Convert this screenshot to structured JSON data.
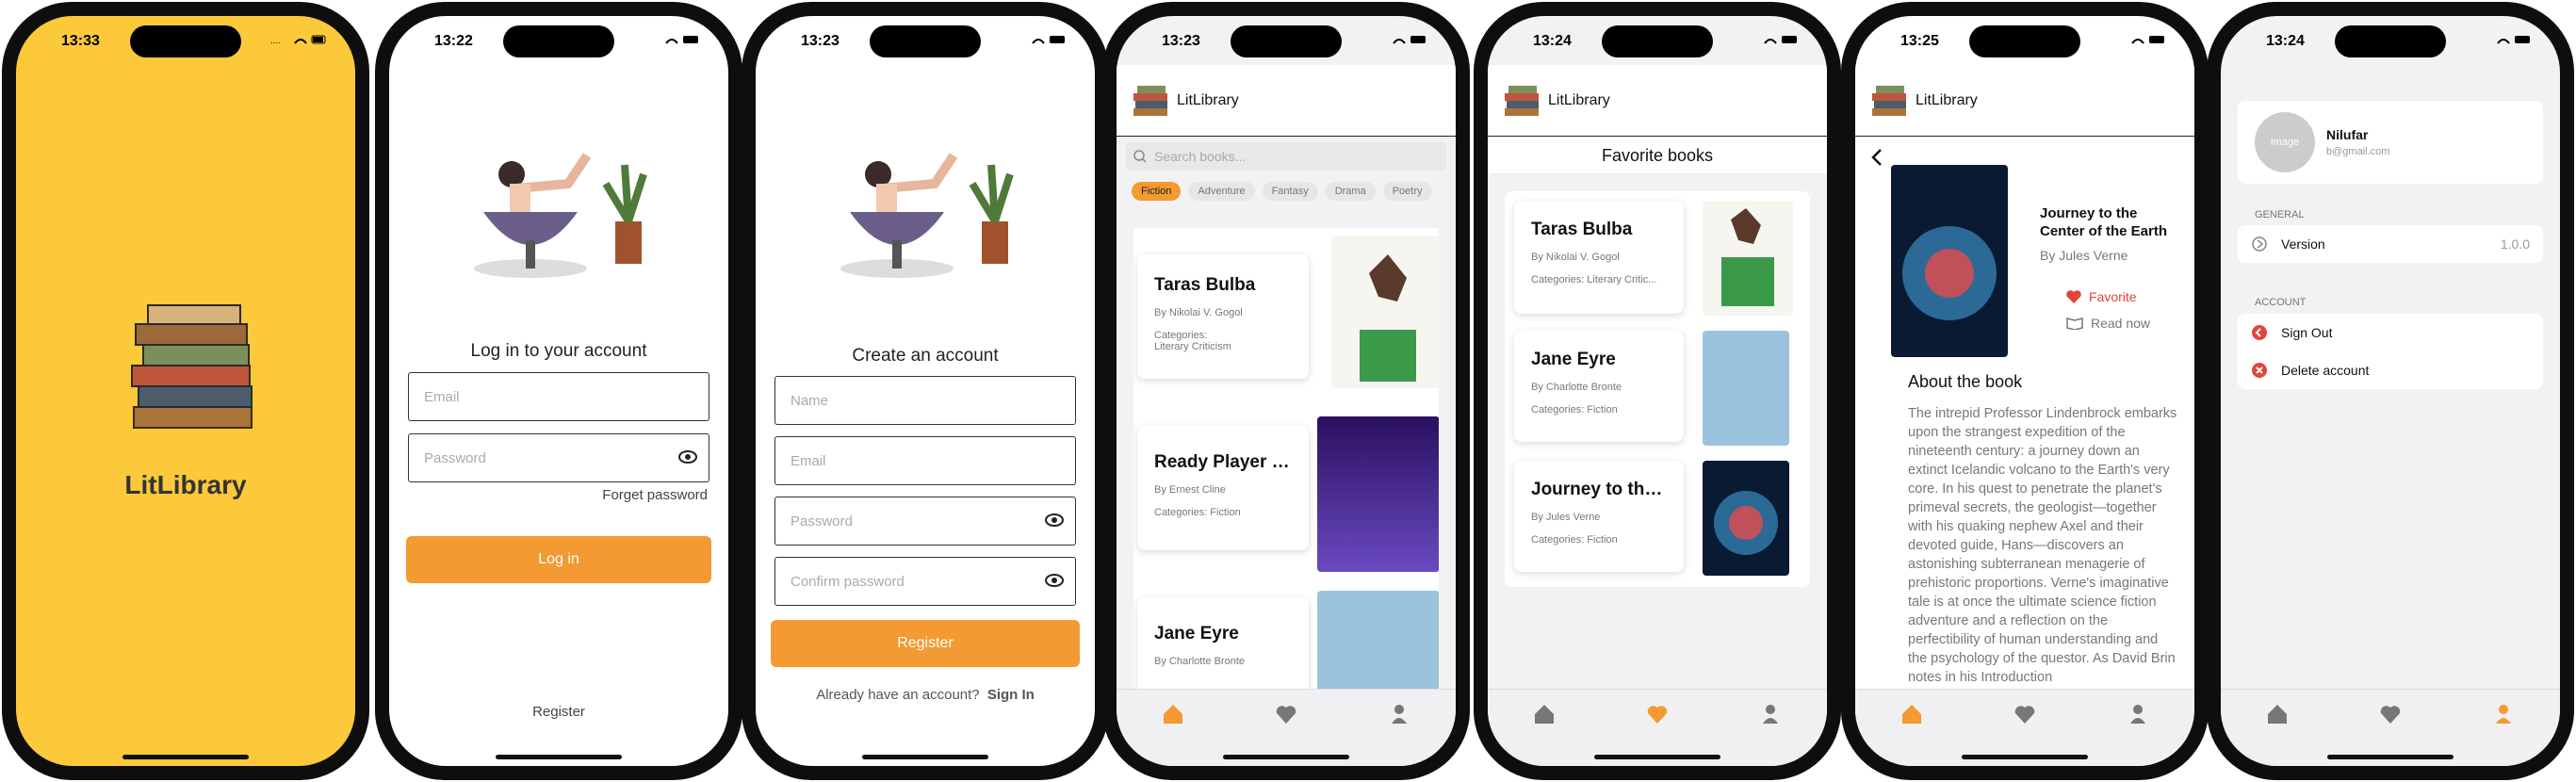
{
  "status": {
    "times": [
      "13:33",
      "13:22",
      "13:23",
      "13:23",
      "13:24",
      "13:25",
      "13:24"
    ]
  },
  "app_name": "LitLibrary",
  "login": {
    "title": "Log in to your account",
    "email_placeholder": "Email",
    "password_placeholder": "Password",
    "forget": "Forget password",
    "button": "Log in",
    "register": "Register"
  },
  "signup": {
    "title": "Create an account",
    "name_placeholder": "Name",
    "email_placeholder": "Email",
    "password_placeholder": "Password",
    "confirm_placeholder": "Confirm password",
    "button": "Register",
    "footer": "Already have an account?",
    "signin": "Sign In"
  },
  "home": {
    "search_placeholder": "Search books...",
    "chips": [
      "Fiction",
      "Adventure",
      "Fantasy",
      "Drama",
      "Poetry"
    ],
    "books": [
      {
        "title": "Taras Bulba",
        "author": "By Nikolai V. Gogol",
        "categories_label": "Categories:",
        "categories": "Literary Criticism"
      },
      {
        "title": "Ready Player T...",
        "author": "By Ernest Cline",
        "categories": "Categories: Fiction"
      },
      {
        "title": "Jane Eyre",
        "author": "By Charlotte Bronte"
      }
    ]
  },
  "favorites": {
    "title": "Favorite books",
    "books": [
      {
        "title": "Taras Bulba",
        "author": "By Nikolai V. Gogol",
        "categories": "Categories: Literary Critic..."
      },
      {
        "title": "Jane Eyre",
        "author": "By Charlotte Bronte",
        "categories": "Categories: Fiction"
      },
      {
        "title": "Journey to the...",
        "author": "By Jules Verne",
        "categories": "Categories: Fiction"
      }
    ]
  },
  "detail": {
    "title": "Journey to the Center of the Earth",
    "author": "By Jules Verne",
    "favorite": "Favorite",
    "read": "Read now",
    "about": "About the book",
    "description": "The intrepid Professor Lindenbrock embarks upon the strangest expedition of the nineteenth century: a journey down an extinct Icelandic volcano to the Earth's very core. In his quest to penetrate the planet's primeval secrets, the geologist—together with his quaking nephew Axel and their devoted guide, Hans—discovers an astonishing subterranean menagerie of prehistoric proportions. Verne's imaginative tale is at once the ultimate science fiction adventure and a reflection on the perfectibility of human understanding and the psychology of the questor. As David Brin notes in his Introduction"
  },
  "profile": {
    "avatar": "Image",
    "name": "Nilufar",
    "email": "b@gmail.com",
    "general": "GENERAL",
    "version_label": "Version",
    "version": "1.0.0",
    "account": "ACCOUNT",
    "signout": "Sign Out",
    "delete": "Delete account"
  },
  "colors": {
    "accent": "#F39A32",
    "splash_bg": "#FBC93A",
    "danger": "#E0463A"
  }
}
